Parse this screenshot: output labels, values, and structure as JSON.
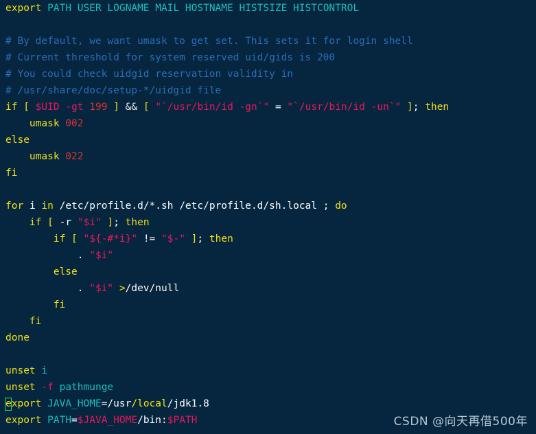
{
  "editor": {
    "app": "vim-terminal-editor",
    "file_kind": "shell-profile-script",
    "background_color": "#06263f",
    "cursor": {
      "shape": "hollow-block",
      "color": "#3ddc60",
      "line_index": 24,
      "column": 1
    },
    "palette": {
      "keyword": "#f2e117",
      "variable": "#19bfbf",
      "comment": "#2b6cb8",
      "string": "#e8175d",
      "number": "#e03131",
      "plain": "#ffffff",
      "operator": "#e6e6e6"
    },
    "lines": [
      {
        "id": 0,
        "tokens": [
          {
            "t": "export",
            "c": "kw"
          },
          {
            "t": " ",
            "c": "plain"
          },
          {
            "t": "PATH USER LOGNAME MAIL HOSTNAME HISTSIZE HISTCONTROL",
            "c": "var"
          }
        ]
      },
      {
        "id": 1,
        "tokens": []
      },
      {
        "id": 2,
        "tokens": [
          {
            "t": "# By default, we want umask to get set. This sets it for login shell",
            "c": "cmt"
          }
        ]
      },
      {
        "id": 3,
        "tokens": [
          {
            "t": "# Current threshold for system reserved uid/gids is 200",
            "c": "cmt"
          }
        ]
      },
      {
        "id": 4,
        "tokens": [
          {
            "t": "# You could check uidgid reservation validity in",
            "c": "cmt"
          }
        ]
      },
      {
        "id": 5,
        "tokens": [
          {
            "t": "# /usr/share/doc/setup-*/uidgid file",
            "c": "cmt"
          }
        ]
      },
      {
        "id": 6,
        "tokens": [
          {
            "t": "if",
            "c": "kw"
          },
          {
            "t": " ",
            "c": "plain"
          },
          {
            "t": "[",
            "c": "kw"
          },
          {
            "t": " ",
            "c": "plain"
          },
          {
            "t": "$UID",
            "c": "str"
          },
          {
            "t": " ",
            "c": "plain"
          },
          {
            "t": "-gt",
            "c": "str"
          },
          {
            "t": " ",
            "c": "plain"
          },
          {
            "t": "199",
            "c": "num"
          },
          {
            "t": " ",
            "c": "plain"
          },
          {
            "t": "]",
            "c": "kw"
          },
          {
            "t": " ",
            "c": "plain"
          },
          {
            "t": "&&",
            "c": "op"
          },
          {
            "t": " ",
            "c": "plain"
          },
          {
            "t": "[",
            "c": "kw"
          },
          {
            "t": " ",
            "c": "plain"
          },
          {
            "t": "\"`/usr/bin/id -gn`\"",
            "c": "str"
          },
          {
            "t": " = ",
            "c": "plain"
          },
          {
            "t": "\"`/usr/bin/id -un`\"",
            "c": "str"
          },
          {
            "t": " ",
            "c": "plain"
          },
          {
            "t": "]",
            "c": "kw"
          },
          {
            "t": "; ",
            "c": "plain"
          },
          {
            "t": "then",
            "c": "kw"
          }
        ]
      },
      {
        "id": 7,
        "tokens": [
          {
            "t": "    ",
            "c": "plain"
          },
          {
            "t": "umask",
            "c": "kw"
          },
          {
            "t": " ",
            "c": "plain"
          },
          {
            "t": "002",
            "c": "num"
          }
        ]
      },
      {
        "id": 8,
        "tokens": [
          {
            "t": "else",
            "c": "kw"
          }
        ]
      },
      {
        "id": 9,
        "tokens": [
          {
            "t": "    ",
            "c": "plain"
          },
          {
            "t": "umask",
            "c": "kw"
          },
          {
            "t": " ",
            "c": "plain"
          },
          {
            "t": "022",
            "c": "num"
          }
        ]
      },
      {
        "id": 10,
        "tokens": [
          {
            "t": "fi",
            "c": "kw"
          }
        ]
      },
      {
        "id": 11,
        "tokens": []
      },
      {
        "id": 12,
        "tokens": [
          {
            "t": "for",
            "c": "kw"
          },
          {
            "t": " ",
            "c": "plain"
          },
          {
            "t": "i",
            "c": "plain"
          },
          {
            "t": " ",
            "c": "plain"
          },
          {
            "t": "in",
            "c": "kw"
          },
          {
            "t": " /etc/profile.d/*.sh /etc/profile.d/sh.local ; ",
            "c": "plain"
          },
          {
            "t": "do",
            "c": "kw"
          }
        ]
      },
      {
        "id": 13,
        "tokens": [
          {
            "t": "    ",
            "c": "plain"
          },
          {
            "t": "if",
            "c": "kw"
          },
          {
            "t": " ",
            "c": "plain"
          },
          {
            "t": "[",
            "c": "kw"
          },
          {
            "t": " ",
            "c": "plain"
          },
          {
            "t": "-r",
            "c": "plain"
          },
          {
            "t": " ",
            "c": "plain"
          },
          {
            "t": "\"$i\"",
            "c": "str"
          },
          {
            "t": " ",
            "c": "plain"
          },
          {
            "t": "]",
            "c": "kw"
          },
          {
            "t": "; ",
            "c": "plain"
          },
          {
            "t": "then",
            "c": "kw"
          }
        ]
      },
      {
        "id": 14,
        "tokens": [
          {
            "t": "        ",
            "c": "plain"
          },
          {
            "t": "if",
            "c": "kw"
          },
          {
            "t": " ",
            "c": "plain"
          },
          {
            "t": "[",
            "c": "kw"
          },
          {
            "t": " ",
            "c": "plain"
          },
          {
            "t": "\"${-#*i}\"",
            "c": "str"
          },
          {
            "t": " != ",
            "c": "plain"
          },
          {
            "t": "\"$-\"",
            "c": "str"
          },
          {
            "t": " ",
            "c": "plain"
          },
          {
            "t": "]",
            "c": "kw"
          },
          {
            "t": "; ",
            "c": "plain"
          },
          {
            "t": "then",
            "c": "kw"
          }
        ]
      },
      {
        "id": 15,
        "tokens": [
          {
            "t": "            . ",
            "c": "plain"
          },
          {
            "t": "\"$i\"",
            "c": "str"
          }
        ]
      },
      {
        "id": 16,
        "tokens": [
          {
            "t": "        ",
            "c": "plain"
          },
          {
            "t": "else",
            "c": "kw"
          }
        ]
      },
      {
        "id": 17,
        "tokens": [
          {
            "t": "            . ",
            "c": "plain"
          },
          {
            "t": "\"$i\"",
            "c": "str"
          },
          {
            "t": " ",
            "c": "plain"
          },
          {
            "t": ">",
            "c": "kw"
          },
          {
            "t": "/dev/null",
            "c": "plain"
          }
        ]
      },
      {
        "id": 18,
        "tokens": [
          {
            "t": "        ",
            "c": "plain"
          },
          {
            "t": "fi",
            "c": "kw"
          }
        ]
      },
      {
        "id": 19,
        "tokens": [
          {
            "t": "    ",
            "c": "plain"
          },
          {
            "t": "fi",
            "c": "kw"
          }
        ]
      },
      {
        "id": 20,
        "tokens": [
          {
            "t": "done",
            "c": "kw"
          }
        ]
      },
      {
        "id": 21,
        "tokens": []
      },
      {
        "id": 22,
        "tokens": [
          {
            "t": "unset",
            "c": "kw"
          },
          {
            "t": " ",
            "c": "plain"
          },
          {
            "t": "i",
            "c": "var"
          }
        ]
      },
      {
        "id": 23,
        "tokens": [
          {
            "t": "unset",
            "c": "kw"
          },
          {
            "t": " ",
            "c": "plain"
          },
          {
            "t": "-f",
            "c": "str"
          },
          {
            "t": " ",
            "c": "plain"
          },
          {
            "t": "pathmunge",
            "c": "var"
          }
        ]
      },
      {
        "id": 24,
        "tokens": [
          {
            "t": "export",
            "c": "kw"
          },
          {
            "t": " ",
            "c": "plain"
          },
          {
            "t": "JAVA_HOME",
            "c": "var"
          },
          {
            "t": "=",
            "c": "plain"
          },
          {
            "t": "/usr",
            "c": "plain"
          },
          {
            "t": "/",
            "c": "kw"
          },
          {
            "t": "local",
            "c": "kw"
          },
          {
            "t": "/jdk1.8",
            "c": "plain"
          }
        ]
      },
      {
        "id": 25,
        "tokens": [
          {
            "t": "export",
            "c": "kw"
          },
          {
            "t": " ",
            "c": "plain"
          },
          {
            "t": "PATH",
            "c": "var"
          },
          {
            "t": "=",
            "c": "plain"
          },
          {
            "t": "$JAVA_HOME",
            "c": "str"
          },
          {
            "t": "/bin:",
            "c": "plain"
          },
          {
            "t": "$PATH",
            "c": "str"
          }
        ]
      }
    ]
  },
  "watermark": {
    "text": "CSDN @向天再借500年"
  }
}
